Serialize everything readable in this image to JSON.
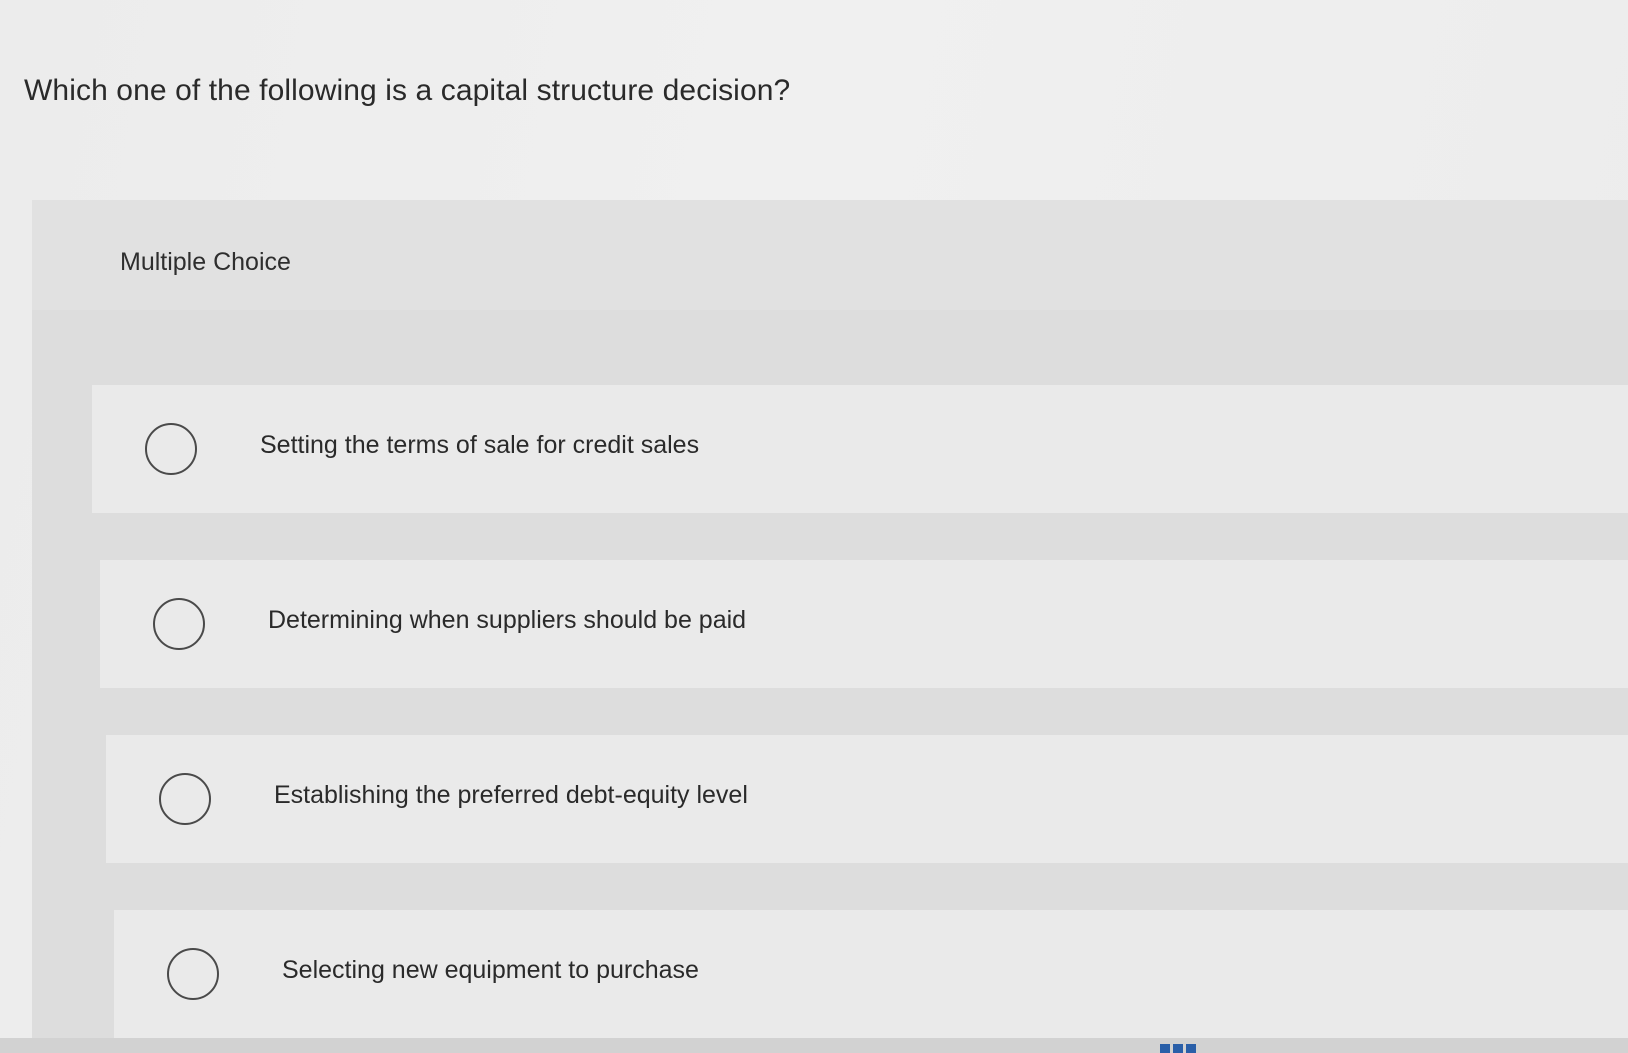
{
  "question": {
    "text": "Which one of the following is a capital structure decision?"
  },
  "multiple_choice": {
    "label": "Multiple Choice",
    "options": [
      {
        "label": "Setting the terms of sale for credit sales",
        "selected": false
      },
      {
        "label": "Determining when suppliers should be paid",
        "selected": false
      },
      {
        "label": "Establishing the preferred debt-equity level",
        "selected": false
      },
      {
        "label": "Selecting new equipment to purchase",
        "selected": false
      }
    ]
  },
  "icons": {
    "radio": "radio-button-icon",
    "bottom": "grid-icon"
  },
  "colors": {
    "background": "#efefef",
    "panel": "#e1e1e1",
    "option_background": "#eaeaea",
    "text": "#2a2a2a",
    "radio_border": "#4a4a4a",
    "accent": "#2a5fa8"
  }
}
